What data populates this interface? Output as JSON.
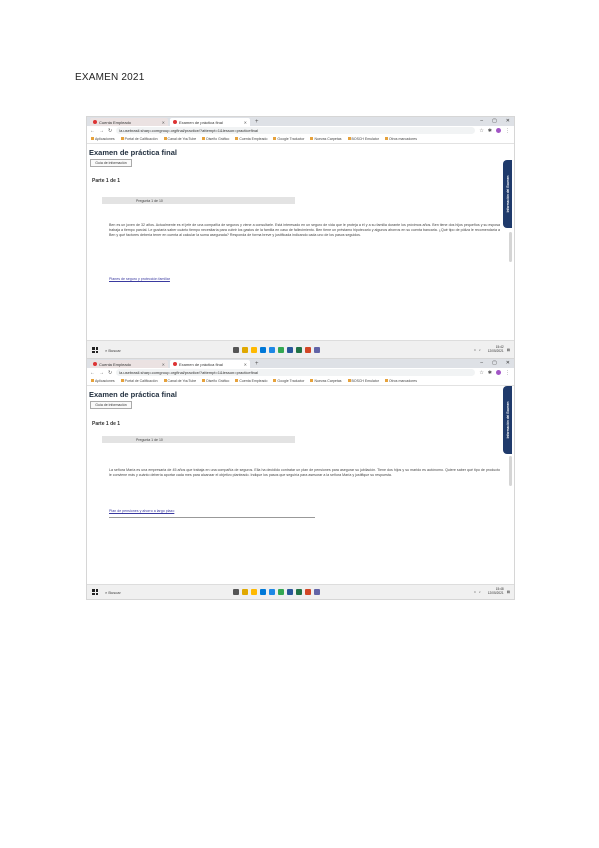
{
  "document": {
    "title": "EXAMEN 2021"
  },
  "browser": {
    "tab_inactive": "Cuenta Empleado",
    "tab_active": "Examen de práctica final",
    "url": "la.usebrasil.sharp.comgroup.orgfinal/practice/?attempt=1&lesson=practicefinal",
    "bookmarks": [
      "Aplicaciones",
      "Portal de Calificación",
      "Canal de YouTube",
      "Diseño Gráfico",
      "Cuenta Empleado",
      "Google Traductor",
      "Nuevas Carpetas",
      "BOSCH Emulator",
      "Otros marcadores"
    ]
  },
  "shots": [
    {
      "exam_title": "Examen de práctica final",
      "info_button": "Guía de información",
      "part_label": "Parte 1 de 1",
      "question_header": "Pregunta 1 de 10",
      "question_text": "Ben es un joven de 32 años. Actualmente es el jefe de una compañía de seguros y viene a consultarle. Está interesado en un seguro de vida que le proteja a él y a su familia durante los próximos años. Ben tiene dos hijos pequeños y su esposa trabaja a tiempo parcial. Le gustaría saber cuánto tiempo necesitaría para cubrir los gastos de la familia en caso de fallecimiento. Ben tiene un préstamo hipotecario y algunos ahorros en su cuenta bancaria. ¿Qué tipo de póliza le recomendaría a Ben y qué factores debería tener en cuenta al calcular la suma asegurada? Responda de forma breve y justificada indicando cada uno de los pasos seguidos.",
      "link_text": "Planes de seguro y protección familiar",
      "side_tab": "Información del Examen",
      "taskbar_search": "Buscar",
      "time": "15:42",
      "date": "12/05/2021"
    },
    {
      "exam_title": "Examen de práctica final",
      "info_button": "Guía de información",
      "part_label": "Parte 1 de 1",
      "question_header": "Pregunta 1 de 10",
      "question_text": "La señora María es una empresaria de 45 años que trabaja en una compañía de seguros. Ella ha decidido contratar un plan de pensiones para asegurar su jubilación. Tiene dos hijos y su marido es autónomo. Quiere saber qué tipo de producto le conviene más y cuánto debería aportar cada mes para alcanzar el objetivo planteado. Indique los pasos que seguiría para asesorar a la señora María y justifique su respuesta.",
      "link_text": "Plan de pensiones y ahorro a largo plazo",
      "side_tab": "Información del Examen",
      "taskbar_search": "Buscar",
      "time": "15:48",
      "date": "12/05/2021"
    }
  ],
  "colors": {
    "side_tab": "#1f3a6b",
    "link": "#3a3aa0"
  }
}
